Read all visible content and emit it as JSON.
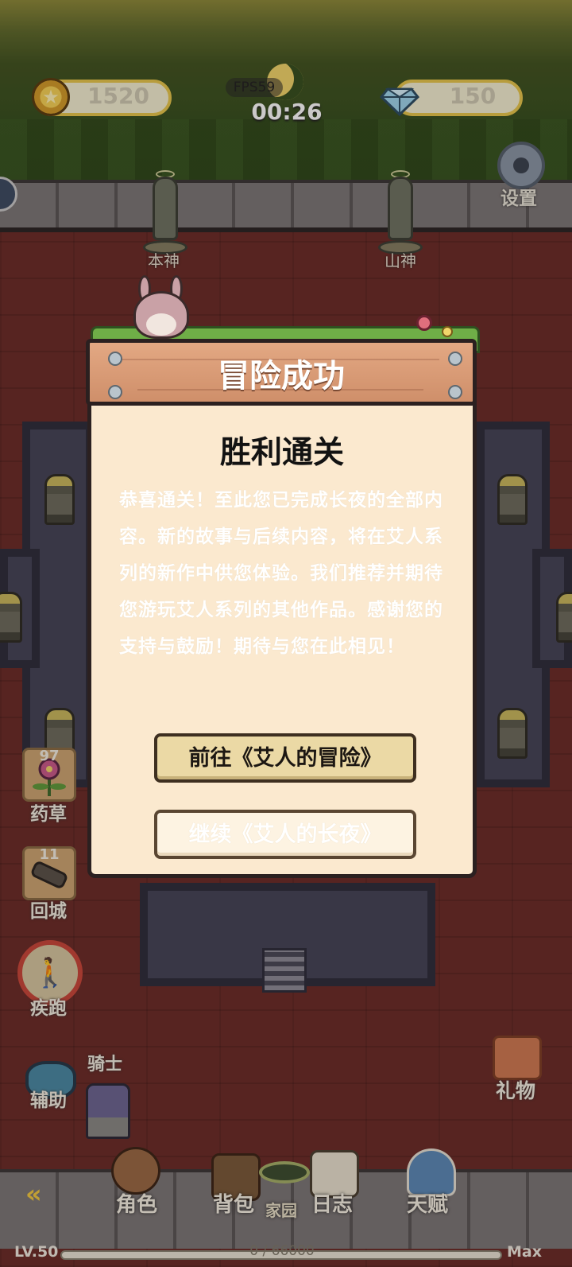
{
  "hud": {
    "coins": "1520",
    "gems": "150",
    "fps": "FPS59",
    "timer": "00:26",
    "settings_label": "设置"
  },
  "scene": {
    "statue_left_label": "本神",
    "statue_right_label": "山神",
    "character_label": "骑士"
  },
  "side": {
    "herb_count": "97",
    "herb_label": "药草",
    "return_count": "11",
    "return_label": "回城",
    "run_label": "疾跑",
    "assist_label": "辅助",
    "gift_label": "礼物"
  },
  "dialog": {
    "title": "冒险成功",
    "heading": "胜利通关",
    "body": "恭喜通关！至此您已完成长夜的全部内容。新的故事与后续内容，将在艾人系列的新作中供您体验。我们推荐并期待您游玩艾人系列的其他作品。感谢您的支持与鼓励！期待与您在此相见！",
    "primary_button": "前往《艾人的冒险》",
    "secondary_button": "继续《艾人的长夜》"
  },
  "nav": {
    "character": "角色",
    "bag": "背包",
    "home": "家园",
    "journal": "日志",
    "talent": "天赋"
  },
  "xp": {
    "level": "LV.50",
    "progress_text": "0 / 66000",
    "max_label": "Max",
    "progress_fraction": 0
  },
  "colors": {
    "accent_gold": "#e7c74c",
    "plank": "#cf8f6a",
    "dialog_bg": "#fbe9cf",
    "floor": "#6b2c28"
  }
}
